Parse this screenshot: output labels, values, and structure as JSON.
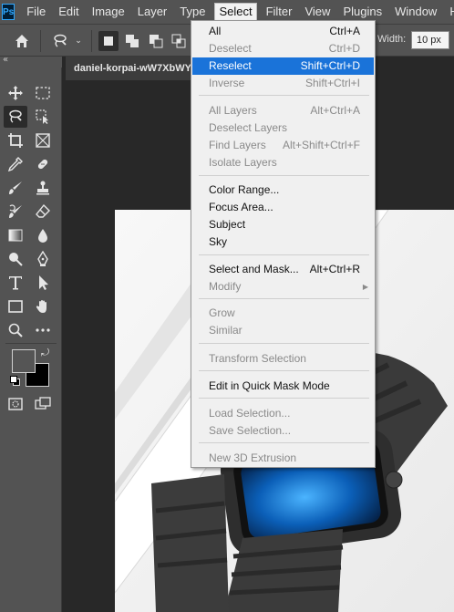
{
  "menubar": {
    "logo": "Ps",
    "items": [
      "File",
      "Edit",
      "Image",
      "Layer",
      "Type",
      "Select",
      "Filter",
      "View",
      "Plugins",
      "Window",
      "Help"
    ],
    "active": "Select"
  },
  "options_bar": {
    "width_label": "Width:",
    "width_value": "10 px"
  },
  "document": {
    "tab_title": "daniel-korpai-wW7XbWY"
  },
  "select_menu": [
    {
      "label": "All",
      "shortcut": "Ctrl+A",
      "state": "enabled"
    },
    {
      "label": "Deselect",
      "shortcut": "Ctrl+D",
      "state": "disabled"
    },
    {
      "label": "Reselect",
      "shortcut": "Shift+Ctrl+D",
      "state": "highlighted"
    },
    {
      "label": "Inverse",
      "shortcut": "Shift+Ctrl+I",
      "state": "disabled"
    },
    {
      "label": "All Layers",
      "shortcut": "Alt+Ctrl+A",
      "state": "disabled"
    },
    {
      "label": "Deselect Layers",
      "shortcut": "",
      "state": "disabled"
    },
    {
      "label": "Find Layers",
      "shortcut": "Alt+Shift+Ctrl+F",
      "state": "disabled"
    },
    {
      "label": "Isolate Layers",
      "shortcut": "",
      "state": "disabled"
    },
    {
      "label": "Color Range...",
      "shortcut": "",
      "state": "enabled"
    },
    {
      "label": "Focus Area...",
      "shortcut": "",
      "state": "enabled"
    },
    {
      "label": "Subject",
      "shortcut": "",
      "state": "enabled"
    },
    {
      "label": "Sky",
      "shortcut": "",
      "state": "enabled"
    },
    {
      "label": "Select and Mask...",
      "shortcut": "Alt+Ctrl+R",
      "state": "enabled"
    },
    {
      "label": "Modify",
      "shortcut": "",
      "state": "disabled",
      "submenu": true
    },
    {
      "label": "Grow",
      "shortcut": "",
      "state": "disabled"
    },
    {
      "label": "Similar",
      "shortcut": "",
      "state": "disabled"
    },
    {
      "label": "Transform Selection",
      "shortcut": "",
      "state": "disabled"
    },
    {
      "label": "Edit in Quick Mask Mode",
      "shortcut": "",
      "state": "enabled"
    },
    {
      "label": "Load Selection...",
      "shortcut": "",
      "state": "disabled"
    },
    {
      "label": "Save Selection...",
      "shortcut": "",
      "state": "disabled"
    },
    {
      "label": "New 3D Extrusion",
      "shortcut": "",
      "state": "disabled"
    }
  ],
  "colors": {
    "highlight": "#1a73d9",
    "panel": "#535353",
    "foreground_swatch": "#555555",
    "background_swatch": "#000000"
  },
  "icons": [
    "ps-logo-icon",
    "home-icon",
    "lasso-icon",
    "move-icon",
    "marquee-icon",
    "crop-icon",
    "eyedropper-icon",
    "brush-icon",
    "stamp-icon",
    "eraser-icon",
    "gradient-icon",
    "pen-icon",
    "type-icon",
    "path-select-icon",
    "rectangle-icon",
    "hand-icon",
    "zoom-icon",
    "more-icon",
    "quick-mask-icon",
    "screen-mode-icon",
    "chevron-right-icon"
  ]
}
